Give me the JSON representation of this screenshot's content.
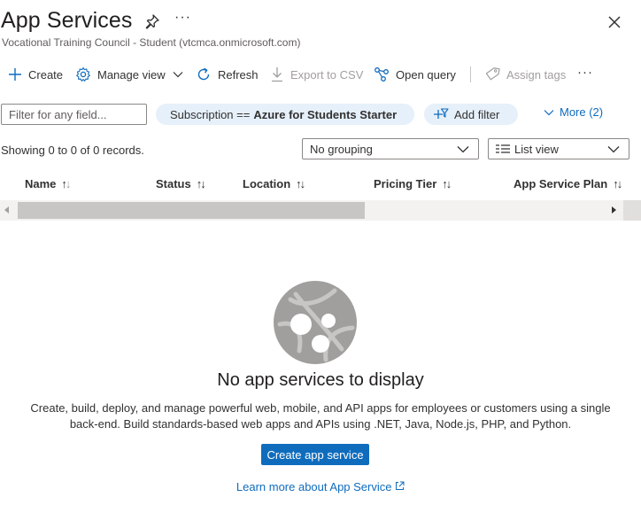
{
  "header": {
    "title": "App Services",
    "subtitle": "Vocational Training Council - Student (vtcmca.onmicrosoft.com)",
    "more": "···"
  },
  "toolbar": {
    "create": "Create",
    "manage_view": "Manage view",
    "refresh": "Refresh",
    "export_csv": "Export to CSV",
    "open_query": "Open query",
    "assign_tags": "Assign tags",
    "more": "···"
  },
  "filters": {
    "placeholder": "Filter for any field...",
    "subscription_label": "Subscription ==",
    "subscription_value": "Azure for Students Starter",
    "add_filter": "Add filter",
    "more": "More (2)"
  },
  "list": {
    "records": "Showing 0 to 0 of 0 records.",
    "grouping": "No grouping",
    "view": "List view",
    "columns": [
      "Name",
      "Status",
      "Location",
      "Pricing Tier",
      "App Service Plan"
    ]
  },
  "empty_state": {
    "title": "No app services to display",
    "description_line1": "Create, build, deploy, and manage powerful web, mobile, and API apps for employees or customers using a single",
    "description_line2": "back-end. Build standards-based web apps and APIs using .NET, Java, Node.js, PHP, and Python.",
    "button": "Create app service",
    "learn_more": "Learn more about App Service"
  },
  "colors": {
    "accent": "#0f6cbd",
    "pill_bg": "#e6f0fa",
    "disabled": "#a19f9d"
  },
  "icons": [
    "pin-icon",
    "close-icon",
    "plus-icon",
    "gear-icon",
    "chevron-down-icon",
    "refresh-icon",
    "download-icon",
    "query-icon",
    "tag-icon",
    "add-filter-icon",
    "list-view-icon",
    "app-service-globe-icon",
    "external-link-icon"
  ]
}
